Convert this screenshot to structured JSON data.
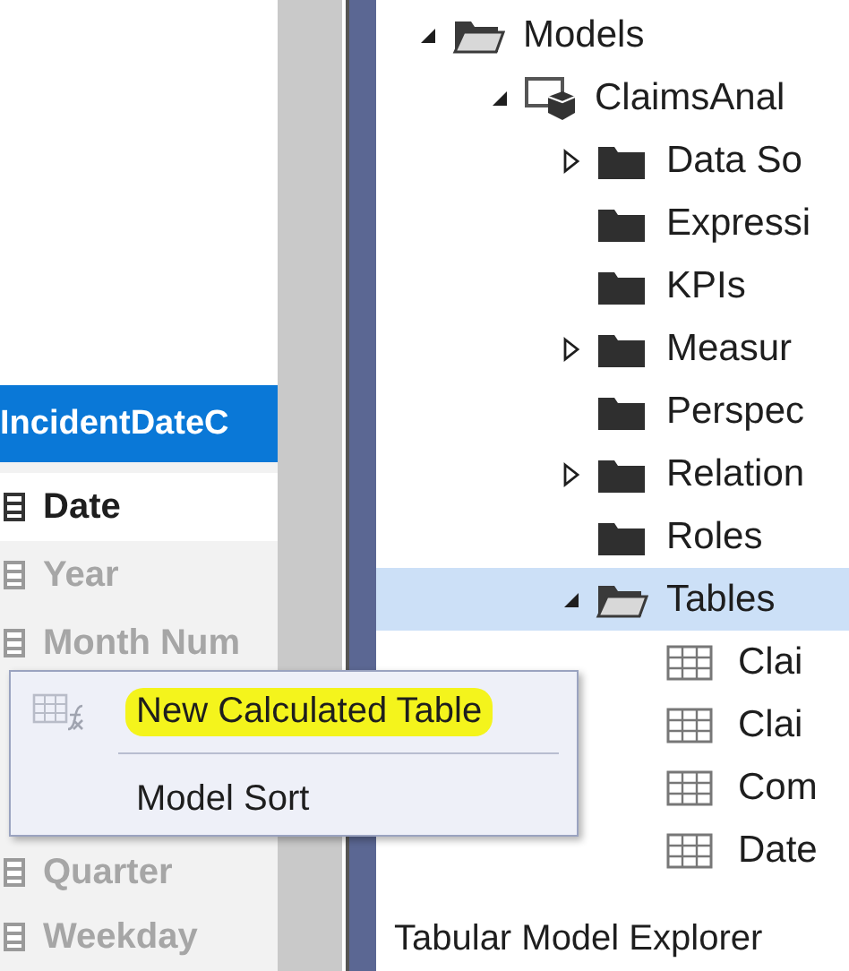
{
  "table_card": {
    "title": "IncidentDateC",
    "columns": [
      {
        "name": "Date",
        "hidden": false
      },
      {
        "name": "Year",
        "hidden": true
      },
      {
        "name": "Month Num",
        "hidden": true
      },
      {
        "name": "Quarter",
        "hidden": true
      },
      {
        "name": "Weekday",
        "hidden": true
      }
    ]
  },
  "context_menu": {
    "items": [
      {
        "kind": "action",
        "label": "New Calculated Table",
        "highlighted": true,
        "disabled": false
      },
      {
        "kind": "separator"
      },
      {
        "kind": "action",
        "label": "Model Sort",
        "highlighted": false,
        "disabled": false
      }
    ]
  },
  "tree": [
    {
      "label": "Models",
      "kind": "folder",
      "expanded": true,
      "selected": false,
      "children": [
        {
          "label": "ClaimsAnal",
          "kind": "model",
          "expanded": true,
          "selected": false,
          "children": [
            {
              "label": "Data So",
              "kind": "folder",
              "expanded": false,
              "selected": false
            },
            {
              "label": "Expressi",
              "kind": "folder",
              "selected": false
            },
            {
              "label": "KPIs",
              "kind": "folder",
              "selected": false
            },
            {
              "label": "Measur",
              "kind": "folder",
              "expanded": false,
              "selected": false
            },
            {
              "label": "Perspec",
              "kind": "folder",
              "selected": false
            },
            {
              "label": "Relation",
              "kind": "folder",
              "expanded": false,
              "selected": false
            },
            {
              "label": "Roles",
              "kind": "folder",
              "selected": false
            },
            {
              "label": "Tables",
              "kind": "folder",
              "expanded": true,
              "selected": true,
              "children": [
                {
                  "label": "Clai",
                  "kind": "table",
                  "selected": false
                },
                {
                  "label": "Clai",
                  "kind": "table",
                  "selected": false
                },
                {
                  "label": "Com",
                  "kind": "table",
                  "selected": false
                },
                {
                  "label": "Date",
                  "kind": "table",
                  "selected": false
                }
              ]
            }
          ]
        }
      ]
    }
  ],
  "status_bar": {
    "title": "Tabular Model Explorer"
  }
}
